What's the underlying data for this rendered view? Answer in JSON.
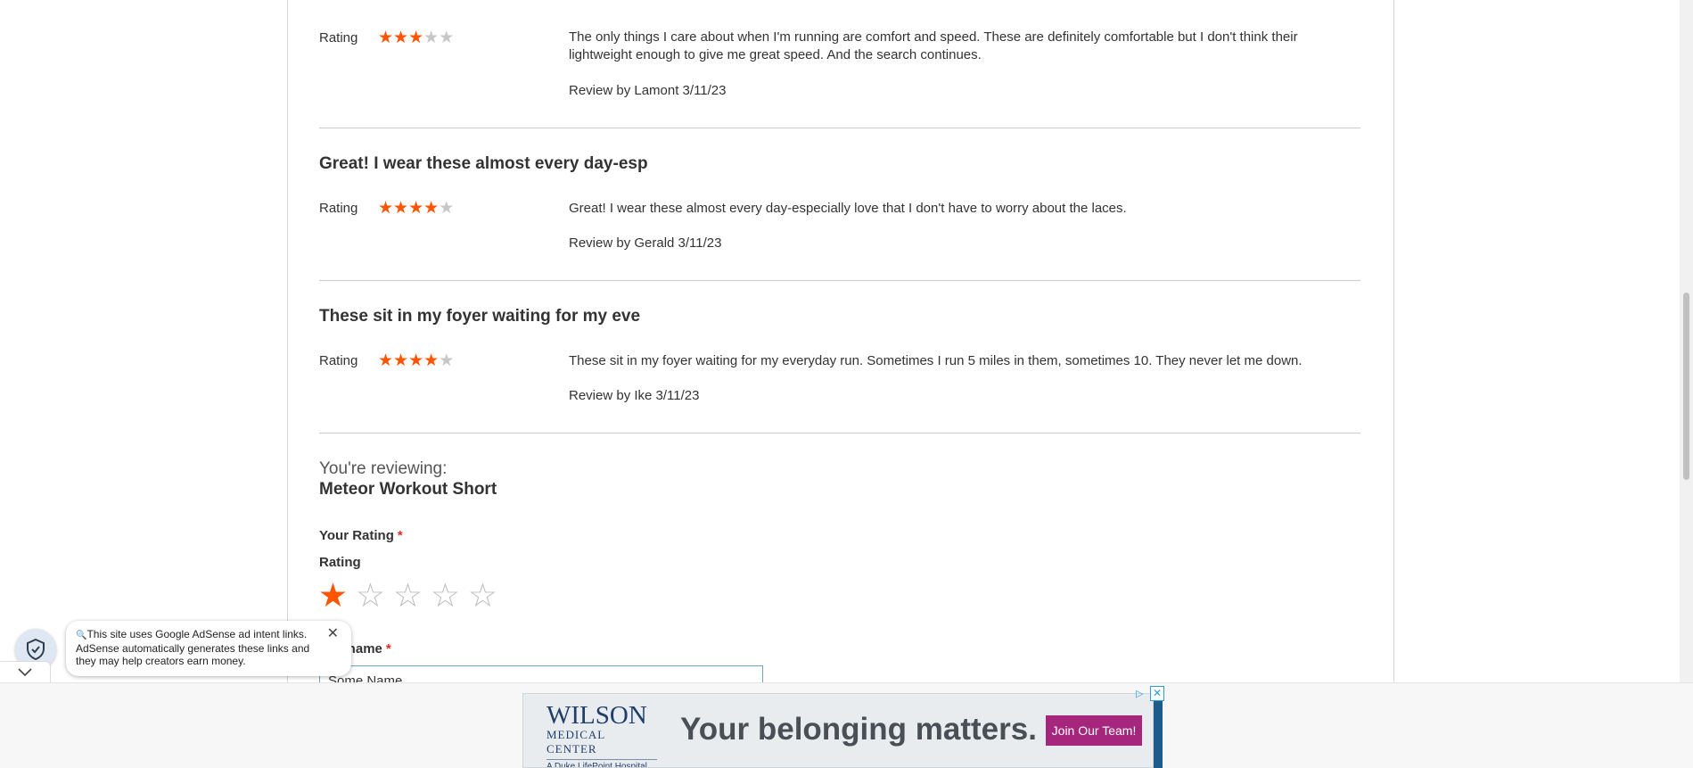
{
  "reviews": [
    {
      "title": "",
      "rating_label": "Rating",
      "stars": 3,
      "text": "The only things I care about when I'm running are comfort and speed. These are definitely comfortable but I don't think their lightweight enough to give me great speed. And the search continues.",
      "review_by": "Review by Lamont 3/11/23"
    },
    {
      "title": "Great! I wear these almost every day-esp",
      "rating_label": "Rating",
      "stars": 4,
      "text": "Great! I wear these almost every day-especially love that I don't have to worry about the laces.",
      "review_by": "Review by Gerald 3/11/23"
    },
    {
      "title": "These sit in my foyer waiting for my eve",
      "rating_label": "Rating",
      "stars": 4,
      "text": "These sit in my foyer waiting for my everyday run. Sometimes I run 5 miles in them, sometimes 10. They never let me down.",
      "review_by": "Review by Ike 3/11/23"
    }
  ],
  "form": {
    "reviewing_label": "You're reviewing:",
    "product_name": "Meteor Workout Short",
    "your_rating_label": "Your Rating",
    "required_mark": "*",
    "rating_label": "Rating",
    "selected_stars": 1,
    "nickname_label": "Nickname",
    "nickname_value": "Some Name"
  },
  "adsense_notice": {
    "text": "This site uses Google AdSense ad intent links. AdSense automatically generates these links and they may help creators earn money.",
    "search_icon": "search-icon",
    "close_icon": "close-icon",
    "shield_icon": "shield-check-icon",
    "collapse_icon": "chevron-down-icon"
  },
  "ad": {
    "logo_line1": "WILSON",
    "logo_line2": "MEDICAL CENTER",
    "logo_line3": "A Duke LifePoint Hospital",
    "headline": "Your belonging matters.",
    "cta": "Join Our Team!"
  },
  "colors": {
    "star_on": "#ff5501",
    "star_off": "#c7c7c7",
    "required": "#e02b27",
    "ad_cta": "#a6267e"
  }
}
